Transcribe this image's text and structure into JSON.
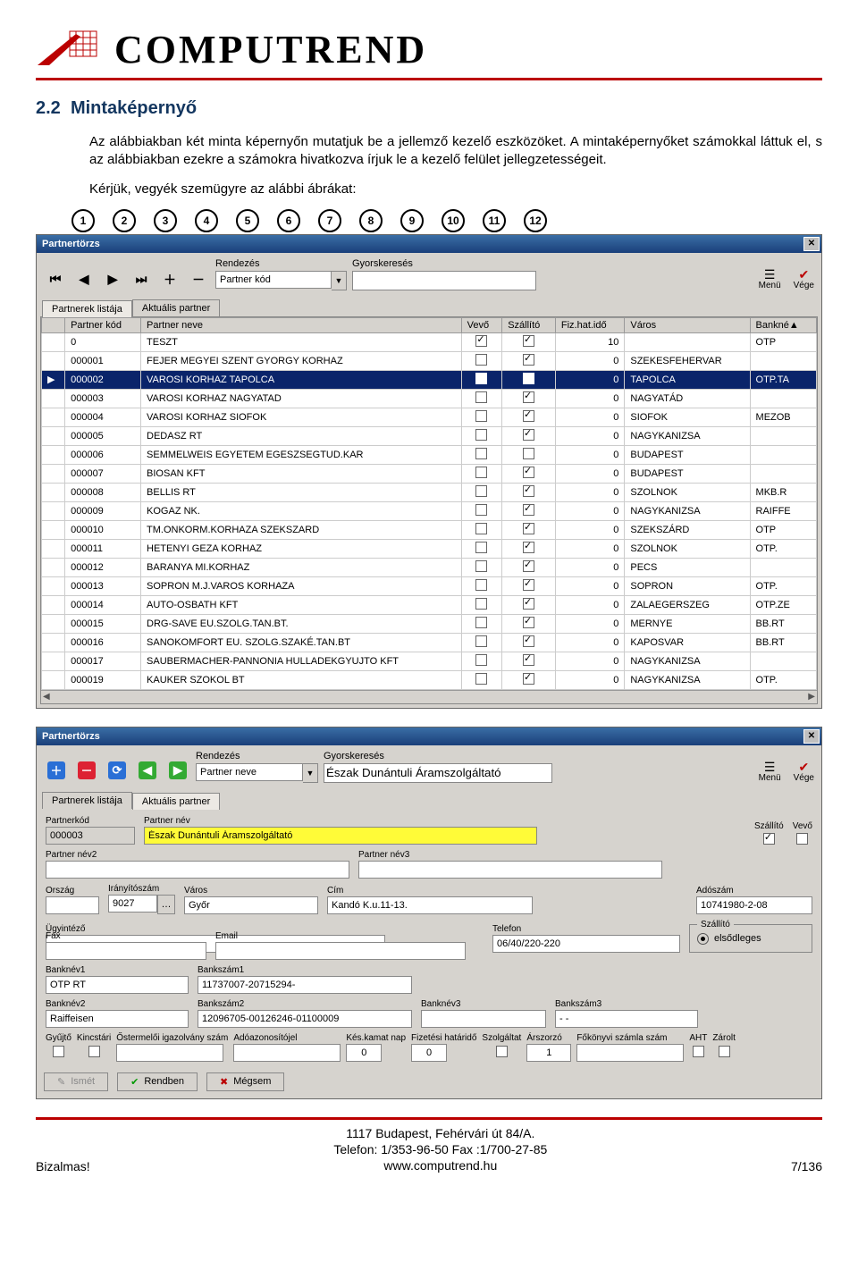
{
  "header": {
    "brand": "COMPUTREND"
  },
  "section": {
    "number": "2.2",
    "title": "Mintaképernyő",
    "para1": "Az alábbiakban két minta képernyőn mutatjuk be a jellemző kezelő eszközöket. A mintaképernyőket számokkal láttuk el, s az alábbiakban ezekre a számokra hivatkozva írjuk le a kezelő felület jellegzetességeit.",
    "para2": "Kérjük, vegyék szemügyre az alábbi ábrákat:",
    "callouts": [
      "1",
      "2",
      "3",
      "4",
      "5",
      "6",
      "7",
      "8",
      "9",
      "10",
      "11",
      "12"
    ]
  },
  "win1": {
    "title": "Partnertörzs",
    "rendezesLabel": "Rendezés",
    "rendezesValue": "Partner kód",
    "gyorsLabel": "Gyorskeresés",
    "gyorsValue": "",
    "menu": "Menü",
    "vege": "Vége",
    "tabs": [
      "Partnerek listája",
      "Aktuális partner"
    ],
    "cols": [
      "",
      "Partner kód",
      "Partner neve",
      "Vevő",
      "Szállító",
      "Fiz.hat.idő",
      "Város",
      "Bankné▲"
    ],
    "rows": [
      {
        "kod": "0",
        "nev": "TESZT",
        "vevo": true,
        "szall": true,
        "ido": "10",
        "varos": "",
        "bank": "OTP"
      },
      {
        "kod": "000001",
        "nev": "FEJER MEGYEI SZENT GYORGY KORHAZ",
        "vevo": false,
        "szall": true,
        "ido": "0",
        "varos": "SZEKESFEHERVAR",
        "bank": ""
      },
      {
        "sel": true,
        "kod": "000002",
        "nev": "VAROSI KORHAZ TAPOLCA",
        "vevo": false,
        "szall": true,
        "ido": "0",
        "varos": "TAPOLCA",
        "bank": "OTP.TA"
      },
      {
        "kod": "000003",
        "nev": "VAROSI KORHAZ NAGYATAD",
        "vevo": false,
        "szall": true,
        "ido": "0",
        "varos": "NAGYATÁD",
        "bank": ""
      },
      {
        "kod": "000004",
        "nev": "VAROSI KORHAZ SIOFOK",
        "vevo": false,
        "szall": true,
        "ido": "0",
        "varos": "SIOFOK",
        "bank": "MEZOB"
      },
      {
        "kod": "000005",
        "nev": "DEDASZ RT",
        "vevo": false,
        "szall": true,
        "ido": "0",
        "varos": "NAGYKANIZSA",
        "bank": ""
      },
      {
        "kod": "000006",
        "nev": "SEMMELWEIS EGYETEM EGESZSEGTUD.KAR",
        "vevo": false,
        "szall": false,
        "ido": "0",
        "varos": "BUDAPEST",
        "bank": ""
      },
      {
        "kod": "000007",
        "nev": "BIOSAN KFT",
        "vevo": false,
        "szall": true,
        "ido": "0",
        "varos": "BUDAPEST",
        "bank": ""
      },
      {
        "kod": "000008",
        "nev": "BELLIS RT",
        "vevo": false,
        "szall": true,
        "ido": "0",
        "varos": "SZOLNOK",
        "bank": "MKB.R"
      },
      {
        "kod": "000009",
        "nev": "KOGAZ NK.",
        "vevo": false,
        "szall": true,
        "ido": "0",
        "varos": "NAGYKANIZSA",
        "bank": "RAIFFE"
      },
      {
        "kod": "000010",
        "nev": "TM.ONKORM.KORHAZA SZEKSZARD",
        "vevo": false,
        "szall": true,
        "ido": "0",
        "varos": "SZEKSZÁRD",
        "bank": "OTP"
      },
      {
        "kod": "000011",
        "nev": "HETENYI GEZA KORHAZ",
        "vevo": false,
        "szall": true,
        "ido": "0",
        "varos": "SZOLNOK",
        "bank": "OTP."
      },
      {
        "kod": "000012",
        "nev": "BARANYA MI.KORHAZ",
        "vevo": false,
        "szall": true,
        "ido": "0",
        "varos": "PECS",
        "bank": ""
      },
      {
        "kod": "000013",
        "nev": "SOPRON M.J.VAROS KORHAZA",
        "vevo": false,
        "szall": true,
        "ido": "0",
        "varos": "SOPRON",
        "bank": "OTP."
      },
      {
        "kod": "000014",
        "nev": "AUTO-OSBATH KFT",
        "vevo": false,
        "szall": true,
        "ido": "0",
        "varos": "ZALAEGERSZEG",
        "bank": "OTP.ZE"
      },
      {
        "kod": "000015",
        "nev": "DRG-SAVE EU.SZOLG.TAN.BT.",
        "vevo": false,
        "szall": true,
        "ido": "0",
        "varos": "MERNYE",
        "bank": "BB.RT"
      },
      {
        "kod": "000016",
        "nev": "SANOKOMFORT EU. SZOLG.SZAKÉ.TAN.BT",
        "vevo": false,
        "szall": true,
        "ido": "0",
        "varos": "KAPOSVAR",
        "bank": "BB.RT"
      },
      {
        "kod": "000017",
        "nev": "SAUBERMACHER-PANNONIA HULLADEKGYUJTO KFT",
        "vevo": false,
        "szall": true,
        "ido": "0",
        "varos": "NAGYKANIZSA",
        "bank": ""
      },
      {
        "kod": "000019",
        "nev": "KAUKER SZOKOL BT",
        "vevo": false,
        "szall": true,
        "ido": "0",
        "varos": "NAGYKANIZSA",
        "bank": "OTP."
      }
    ]
  },
  "win2": {
    "title": "Partnertörzs",
    "rendezesLabel": "Rendezés",
    "rendezesValue": "Partner neve",
    "gyorsLabel": "Gyorskeresés",
    "gyorsValue": "Észak Dunántuli Áramszolgáltató",
    "menu": "Menü",
    "vege": "Vége",
    "tabs": [
      "Partnerek listája",
      "Aktuális partner"
    ],
    "fields": {
      "partnerkodLabel": "Partnerkód",
      "partnerkod": "000003",
      "partnernevLabel": "Partner név",
      "partnernev": "Észak Dunántuli Áramszolgáltató",
      "szallitoLabel": "Szállító",
      "vevoLabel": "Vevő",
      "szallito": true,
      "vevo": false,
      "nev2Label": "Partner név2",
      "nev2": "",
      "nev3Label": "Partner név3",
      "nev3": "",
      "orszagLabel": "Ország",
      "orszag": "",
      "irszLabel": "Irányítószám",
      "irsz": "9027",
      "varosLabel": "Város",
      "varos": "Győr",
      "cimLabel": "Cím",
      "cim": "Kandó K.u.11-13.",
      "adoszamLabel": "Adószám",
      "adoszam": "10741980-2-08",
      "ugyLabel": "Ügyintéző",
      "ugy": "",
      "telLabel": "Telefon",
      "tel": "06/40/220-220",
      "faxLabel": "Fax",
      "fax": "",
      "emailLabel": "Email",
      "email": "",
      "sideTitle": "Szállító",
      "radio": "elsődleges",
      "bn1Label": "Banknév1",
      "bn1": "OTP RT",
      "bs1Label": "Bankszám1",
      "bs1": "11737007-20715294-",
      "bn2Label": "Banknév2",
      "bn2": "Raiffeisen",
      "bs2Label": "Bankszám2",
      "bs2": "12096705-00126246-01100009",
      "bn3Label": "Banknév3",
      "bn3": "",
      "bs3Label": "Bankszám3",
      "bs3": "- -"
    },
    "smallLabels": [
      "Gyűjtő",
      "Kincstári",
      "Őstermelői igazolvány szám",
      "Adóazonosítójel",
      "Kés.kamat nap",
      "Fizetési határidő",
      "Szolgáltat",
      "Árszorzó",
      "Főkönyvi számla szám",
      "AHT",
      "Zárolt"
    ],
    "smallVals": [
      "",
      "",
      "",
      "",
      "0",
      "0",
      "",
      "1",
      "",
      "",
      ""
    ],
    "buttons": {
      "ismet": "Ismét",
      "rendben": "Rendben",
      "megsem": "Mégsem"
    }
  },
  "footer": {
    "left": "Bizalmas!",
    "line1": "1117 Budapest, Fehérvári út 84/A.",
    "line2": "Telefon: 1/353-96-50   Fax :1/700-27-85",
    "line3": "www.computrend.hu",
    "right": "7/136"
  }
}
